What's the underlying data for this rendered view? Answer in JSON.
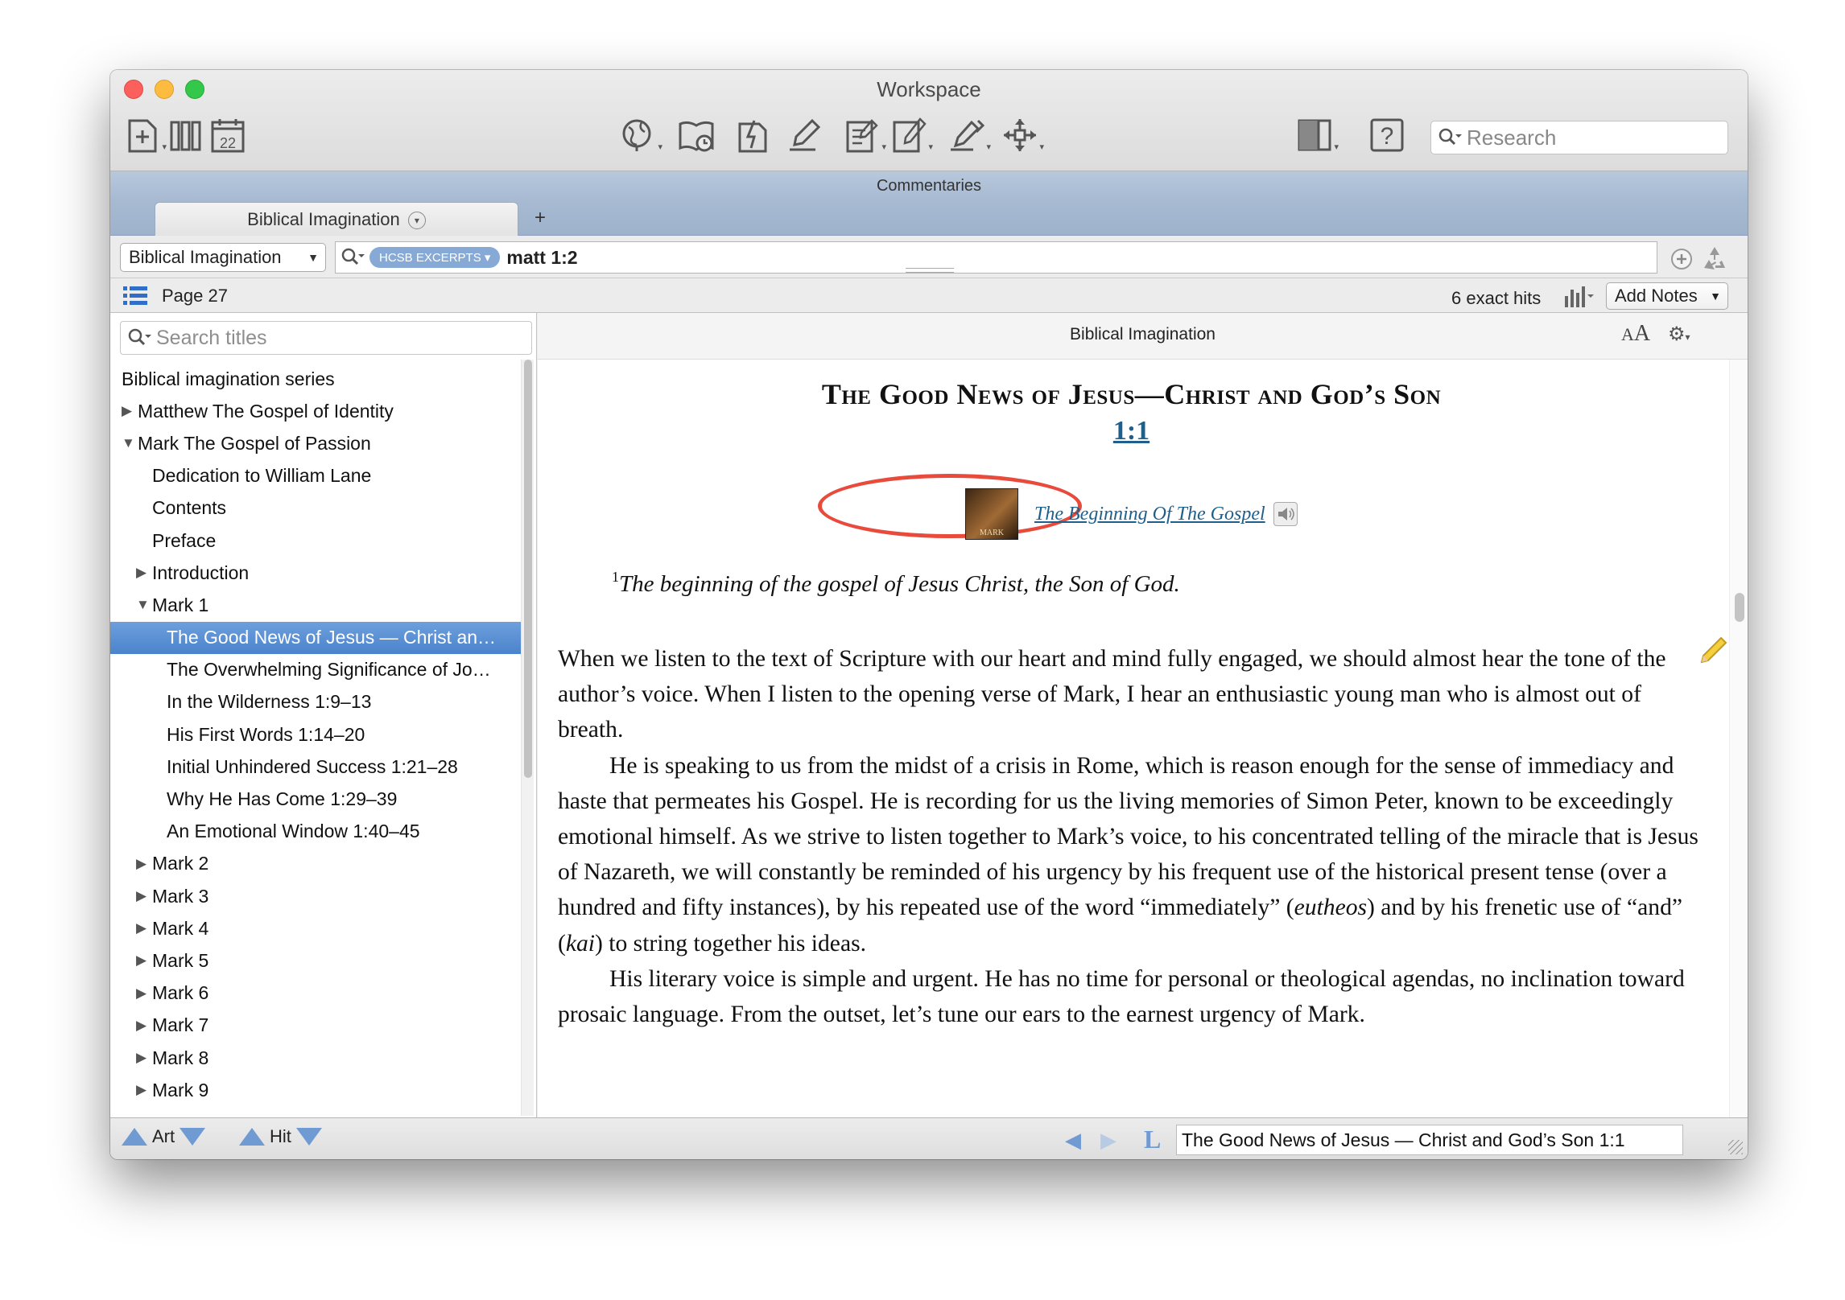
{
  "window": {
    "title": "Workspace"
  },
  "toolbar": {
    "icons": [
      "new-document-icon",
      "library-icon",
      "calendar-icon",
      "globe-icon",
      "book-history-icon",
      "note-icon",
      "highlighter-icon",
      "notepad-icon",
      "edit-document-icon",
      "pens-icon",
      "move-arrows-icon",
      "layout-icon",
      "help-icon"
    ],
    "calendar_day": "22",
    "help_glyph": "?",
    "search_placeholder": "Research"
  },
  "panel": {
    "name": "Commentaries"
  },
  "tab": {
    "label": "Biblical Imagination",
    "add_label": "+"
  },
  "search": {
    "resource": "Biblical Imagination",
    "scope": "HCSB EXCERPTS",
    "query": "matt 1:2"
  },
  "info_bar": {
    "page": "Page 27",
    "hits": "6 exact hits",
    "add_notes": "Add Notes"
  },
  "sidebar": {
    "search_placeholder": "Search titles",
    "items": [
      {
        "label": "Biblical imagination series",
        "level": 0,
        "toggle": ""
      },
      {
        "label": "Matthew The Gospel of Identity",
        "level": 0,
        "toggle": "closed"
      },
      {
        "label": "Mark The Gospel of Passion",
        "level": 0,
        "toggle": "open"
      },
      {
        "label": "Dedication to William Lane",
        "level": 1,
        "toggle": ""
      },
      {
        "label": "Contents",
        "level": 1,
        "toggle": ""
      },
      {
        "label": "Preface",
        "level": 1,
        "toggle": ""
      },
      {
        "label": "Introduction",
        "level": 1,
        "toggle": "closed"
      },
      {
        "label": "Mark 1",
        "level": 1,
        "toggle": "open"
      },
      {
        "label": "The Good News of Jesus — Christ an…",
        "level": 2,
        "toggle": "",
        "selected": true
      },
      {
        "label": "The Overwhelming Significance of Jo…",
        "level": 2,
        "toggle": ""
      },
      {
        "label": "In the Wilderness 1:9–13",
        "level": 2,
        "toggle": ""
      },
      {
        "label": "His First Words 1:14–20",
        "level": 2,
        "toggle": ""
      },
      {
        "label": "Initial Unhindered Success 1:21–28",
        "level": 2,
        "toggle": ""
      },
      {
        "label": "Why He Has Come 1:29–39",
        "level": 2,
        "toggle": ""
      },
      {
        "label": "An Emotional Window 1:40–45",
        "level": 2,
        "toggle": ""
      },
      {
        "label": "Mark 2",
        "level": 1,
        "toggle": "closed"
      },
      {
        "label": "Mark 3",
        "level": 1,
        "toggle": "closed"
      },
      {
        "label": "Mark 4",
        "level": 1,
        "toggle": "closed"
      },
      {
        "label": "Mark 5",
        "level": 1,
        "toggle": "closed"
      },
      {
        "label": "Mark 6",
        "level": 1,
        "toggle": "closed"
      },
      {
        "label": "Mark 7",
        "level": 1,
        "toggle": "closed"
      },
      {
        "label": "Mark 8",
        "level": 1,
        "toggle": "closed"
      },
      {
        "label": "Mark 9",
        "level": 1,
        "toggle": "closed"
      }
    ]
  },
  "content": {
    "header_title": "Biblical Imagination",
    "font_size_label": "AA",
    "heading": "The Good News of Jesus—Christ and God’s Son",
    "verse_ref": "1:1",
    "media_label": "The Beginning Of The Gospel",
    "media_thumb_label": "MARK",
    "verse_number": "1",
    "verse_text": "The beginning of the gospel of Jesus Christ, the Son of God.",
    "paragraphs": [
      {
        "indent": false,
        "segments": [
          {
            "t": "When we listen to the text of Scripture with our heart and mind fully engaged, we should almost hear the tone of the author’s voice. When I listen to the opening verse of Mark, I hear an enthusiastic young man who is almost out of breath."
          }
        ]
      },
      {
        "indent": true,
        "segments": [
          {
            "t": "He is speaking to us from the midst of a crisis in Rome, which is reason enough for the sense of immediacy and haste that permeates his Gospel. He is recording for us the living memories of Simon Peter, known to be exceedingly emotional himself. As we strive to listen together to Mark’s voice, to his concentrated telling of the miracle that is Jesus of Nazareth, we will constantly be reminded of his urgency by his frequent use of the historical present tense (over a hundred and fifty instances), by his repeated use of the word “immediately” ("
          },
          {
            "t": "eutheos",
            "i": true
          },
          {
            "t": ") and by his frenetic use of “and” ("
          },
          {
            "t": "kai",
            "i": true
          },
          {
            "t": ") to string together his ideas."
          }
        ]
      },
      {
        "indent": true,
        "segments": [
          {
            "t": "His literary voice is simple and urgent. He has no time for personal or theological agendas, no inclination toward prosaic language. From the outset, let’s tune our ears to the earnest urgency of Mark."
          }
        ]
      }
    ]
  },
  "bottom_bar": {
    "art_label": "Art",
    "hit_label": "Hit",
    "link_glyph": "L",
    "location": "The Good News of Jesus — Christ and God’s Son 1:1"
  },
  "colors": {
    "accent": "#6f9ad2",
    "selection": "#4b83cc",
    "link": "#1f5f8c",
    "annotation_ring": "#e84a3c"
  }
}
